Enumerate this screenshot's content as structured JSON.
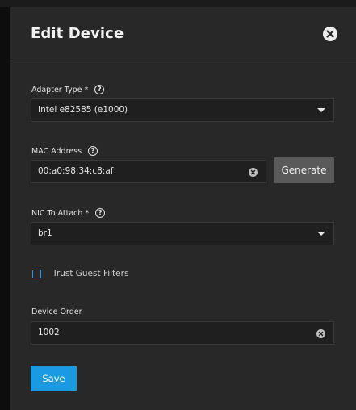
{
  "dialog": {
    "title": "Edit Device"
  },
  "form": {
    "adapter_type": {
      "label": "Adapter Type *",
      "value": "Intel e82585 (e1000)"
    },
    "mac_address": {
      "label": "MAC Address",
      "value": "00:a0:98:34:c8:af",
      "generate_label": "Generate"
    },
    "nic_to_attach": {
      "label": "NIC To Attach *",
      "value": "br1"
    },
    "trust_guest_filters": {
      "label": "Trust Guest Filters",
      "checked": false
    },
    "device_order": {
      "label": "Device Order",
      "value": "1002"
    },
    "save_label": "Save"
  },
  "colors": {
    "accent": "#1a9ae0",
    "panel_bg": "#282828",
    "field_bg": "#1f1f1f",
    "checkbox_border": "#2b9bd6"
  },
  "icons": {
    "close": "close-circle-icon",
    "help": "question-circle-icon",
    "clear": "clear-circle-icon",
    "dropdown": "caret-down-icon"
  }
}
